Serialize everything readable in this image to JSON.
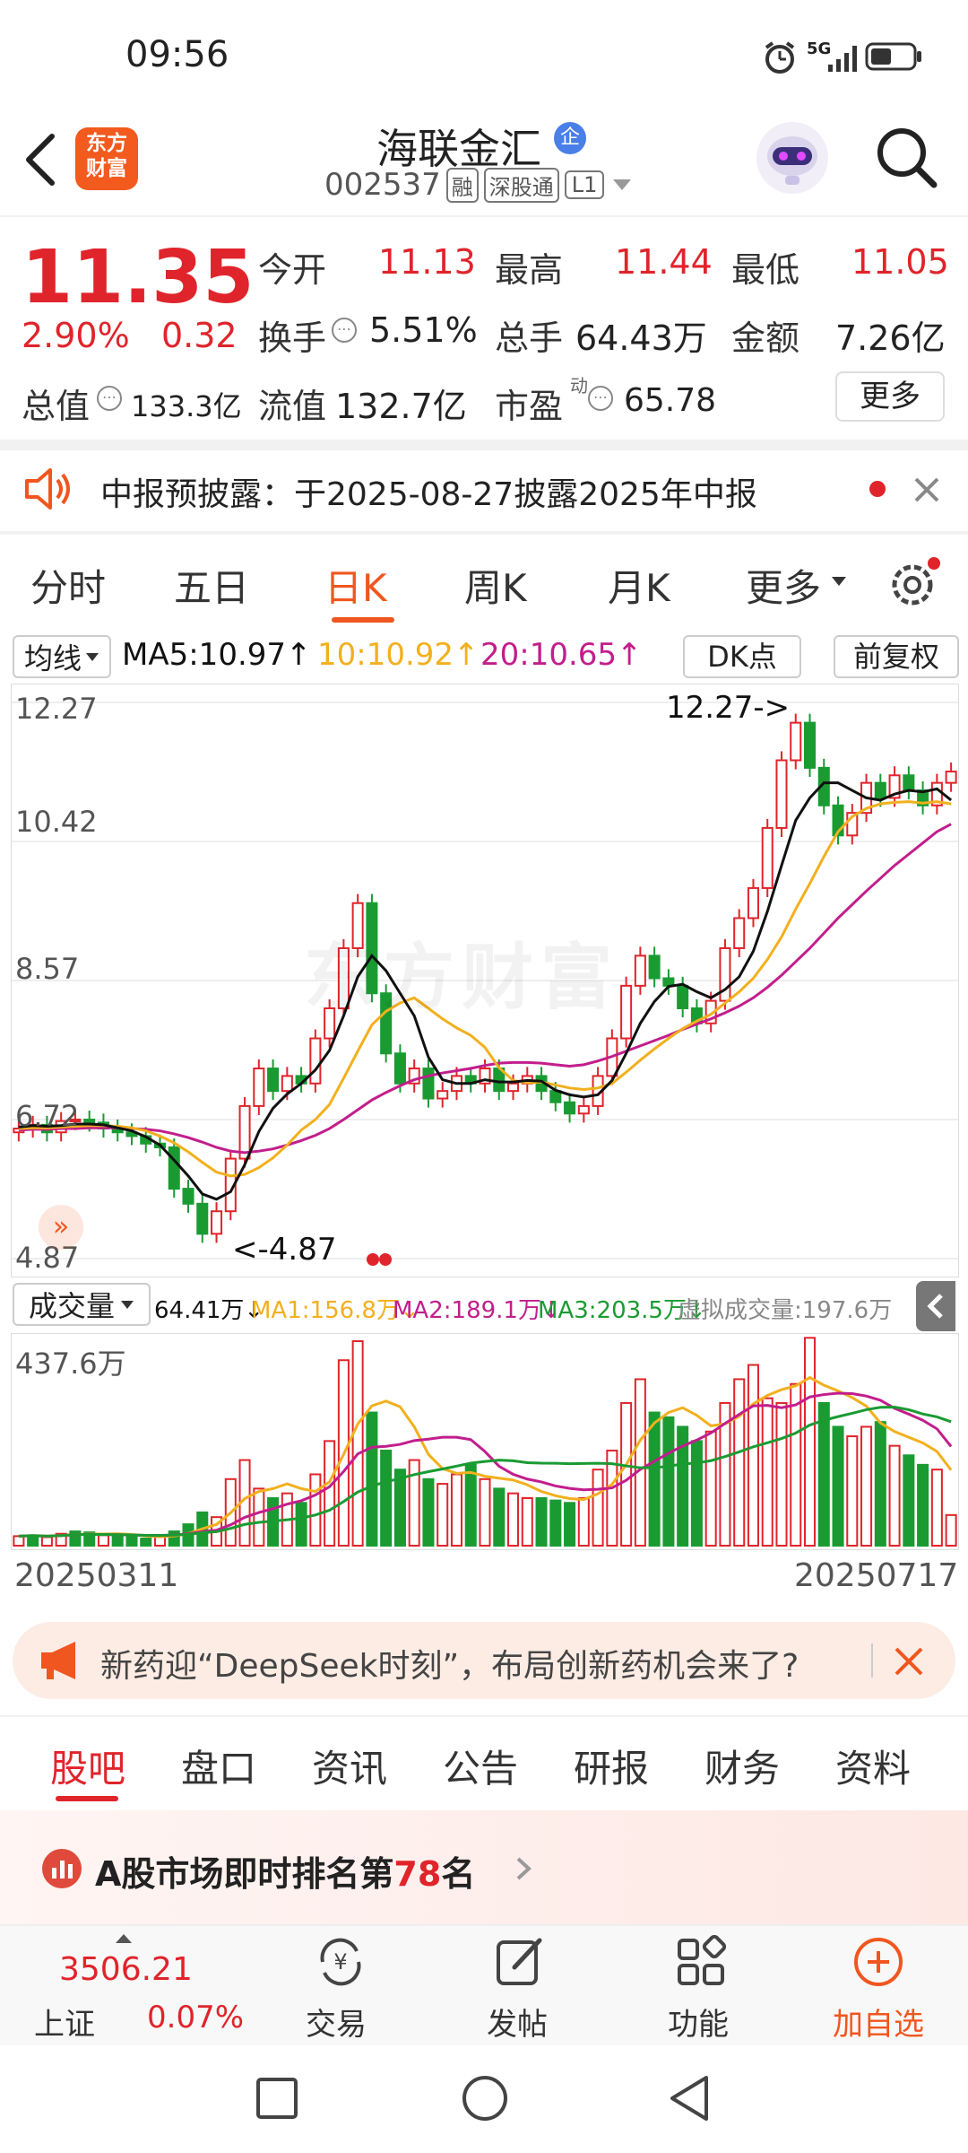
{
  "status_bar": {
    "time": "09:56",
    "network": "5G"
  },
  "header": {
    "logo_line1": "东方",
    "logo_line2": "财富",
    "stock_name": "海联金汇",
    "enterprise_badge": "企",
    "stock_code": "002537",
    "tags": [
      "融",
      "深股通"
    ],
    "level": "L1"
  },
  "quote": {
    "price": "11.35",
    "change_pct": "2.90%",
    "change_abs": "0.32",
    "open_label": "今开",
    "open": "11.13",
    "high_label": "最高",
    "high": "11.44",
    "low_label": "最低",
    "low": "11.05",
    "turnover_label": "换手",
    "turnover": "5.51%",
    "volume_label": "总手",
    "volume": "64.43万",
    "amount_label": "金额",
    "amount": "7.26亿",
    "mktcap_label": "总值",
    "mktcap": "133.3亿",
    "float_label": "流值",
    "float": "132.7亿",
    "pe_label": "市盈",
    "pe_superscript": "动",
    "pe": "65.78",
    "more_button": "更多"
  },
  "notice": {
    "text": "中报预披露：于2025-08-27披露2025年中报"
  },
  "chart_tabs": [
    "分时",
    "五日",
    "日K",
    "周K",
    "月K",
    "更多"
  ],
  "chart_tab_active": "日K",
  "chart_controls": {
    "indicator": "均线",
    "ma5": "MA5:10.97↑",
    "ma10": "10:10.92↑",
    "ma20": "20:10.65↑",
    "dk_button": "DK点",
    "adjust_button": "前复权"
  },
  "colors": {
    "up": "#e0242b",
    "down": "#1a9b32",
    "ma5": "#111111",
    "ma10": "#f2b01e",
    "ma20": "#c21e8c",
    "accent": "#f0561f",
    "vol_ma3": "#1a9b32"
  },
  "chart_data": [
    {
      "type": "candlestick",
      "y_ticks": [
        "12.27",
        "10.42",
        "8.57",
        "6.72",
        "4.87"
      ],
      "ylim": [
        4.87,
        12.27
      ],
      "max_annotation": "12.27->",
      "min_annotation": "<-4.87",
      "watermark": "东方财富",
      "close": [
        6.6,
        6.65,
        6.55,
        6.7,
        6.72,
        6.68,
        6.6,
        6.55,
        6.5,
        6.4,
        6.35,
        5.8,
        5.6,
        5.2,
        5.5,
        6.2,
        6.9,
        7.4,
        7.1,
        7.3,
        7.2,
        7.8,
        8.2,
        9.0,
        9.6,
        8.4,
        7.6,
        7.2,
        7.4,
        7.0,
        7.1,
        7.3,
        7.2,
        7.4,
        7.1,
        7.2,
        7.3,
        7.1,
        6.95,
        6.8,
        6.9,
        7.3,
        7.8,
        8.5,
        8.9,
        8.6,
        8.5,
        8.2,
        8.0,
        8.3,
        9.0,
        9.4,
        9.8,
        10.6,
        11.5,
        12.0,
        11.4,
        10.9,
        10.5,
        10.8,
        11.2,
        11.0,
        11.3,
        11.1,
        10.9,
        11.2,
        11.35
      ],
      "ma5": [
        6.62,
        6.64,
        6.63,
        6.64,
        6.66,
        6.66,
        6.65,
        6.61,
        6.57,
        6.49,
        6.38,
        6.18,
        5.97,
        5.73,
        5.66,
        5.76,
        6.12,
        6.56,
        6.87,
        7.06,
        7.2,
        7.38,
        7.64,
        8.1,
        8.62,
        8.9,
        8.7,
        8.4,
        8.1,
        7.55,
        7.25,
        7.2,
        7.2,
        7.25,
        7.22,
        7.22,
        7.24,
        7.23,
        7.11,
        7.05,
        7.02,
        7.05,
        7.24,
        7.6,
        8.0,
        8.29,
        8.49,
        8.52,
        8.42,
        8.34,
        8.45,
        8.62,
        8.96,
        9.49,
        10.1,
        10.7,
        11.0,
        11.2,
        11.2,
        11.1,
        11.0,
        10.97,
        11.05,
        11.1,
        11.08,
        11.12,
        10.97
      ],
      "ma10": [
        6.6,
        6.61,
        6.61,
        6.62,
        6.63,
        6.64,
        6.64,
        6.63,
        6.61,
        6.57,
        6.5,
        6.41,
        6.29,
        6.15,
        6.02,
        5.97,
        5.99,
        6.08,
        6.21,
        6.38,
        6.58,
        6.72,
        6.92,
        7.27,
        7.63,
        7.98,
        8.16,
        8.27,
        8.34,
        8.2,
        8.06,
        7.94,
        7.84,
        7.68,
        7.41,
        7.24,
        7.21,
        7.22,
        7.18,
        7.14,
        7.12,
        7.14,
        7.2,
        7.35,
        7.51,
        7.66,
        7.8,
        7.93,
        8.03,
        8.12,
        8.27,
        8.42,
        8.6,
        8.85,
        9.15,
        9.52,
        9.86,
        10.22,
        10.55,
        10.75,
        10.86,
        10.92,
        10.94,
        10.95,
        10.93,
        10.95,
        10.92
      ],
      "ma20": [
        6.58,
        6.59,
        6.59,
        6.6,
        6.6,
        6.61,
        6.61,
        6.61,
        6.6,
        6.59,
        6.57,
        6.53,
        6.48,
        6.42,
        6.35,
        6.3,
        6.28,
        6.3,
        6.33,
        6.38,
        6.44,
        6.51,
        6.6,
        6.72,
        6.85,
        6.98,
        7.08,
        7.17,
        7.25,
        7.3,
        7.34,
        7.37,
        7.4,
        7.44,
        7.47,
        7.48,
        7.48,
        7.47,
        7.45,
        7.43,
        7.45,
        7.5,
        7.56,
        7.63,
        7.7,
        7.77,
        7.84,
        7.92,
        7.99,
        8.06,
        8.14,
        8.23,
        8.34,
        8.48,
        8.64,
        8.82,
        9.0,
        9.2,
        9.4,
        9.58,
        9.76,
        9.93,
        10.1,
        10.25,
        10.4,
        10.55,
        10.65
      ]
    },
    {
      "type": "bar",
      "label": "成交量",
      "current": "64.41万↓",
      "ma1": "MA1:156.8万↓",
      "ma2": "MA2:189.1万↓",
      "ma3": "MA3:203.5万↓",
      "virtual": "虚拟成交量:197.6万",
      "y_max_label": "437.6万",
      "x_start": "20250311",
      "x_end": "20250717",
      "ylim": [
        0,
        437.6
      ],
      "values": [
        20,
        22,
        18,
        25,
        30,
        28,
        22,
        20,
        18,
        15,
        18,
        30,
        45,
        70,
        60,
        140,
        180,
        120,
        100,
        110,
        90,
        150,
        220,
        390,
        430,
        280,
        200,
        160,
        180,
        140,
        130,
        150,
        170,
        140,
        120,
        110,
        100,
        100,
        95,
        90,
        100,
        160,
        200,
        300,
        350,
        280,
        270,
        250,
        220,
        240,
        300,
        350,
        380,
        310,
        300,
        340,
        437,
        300,
        250,
        230,
        250,
        260,
        210,
        190,
        170,
        160,
        64.41
      ],
      "up": [
        true,
        false,
        true,
        true,
        false,
        false,
        true,
        false,
        false,
        false,
        true,
        false,
        false,
        false,
        true,
        true,
        true,
        true,
        false,
        true,
        false,
        true,
        true,
        true,
        true,
        false,
        false,
        false,
        true,
        false,
        true,
        true,
        false,
        true,
        false,
        true,
        true,
        false,
        false,
        false,
        true,
        true,
        true,
        true,
        true,
        false,
        false,
        false,
        false,
        true,
        true,
        true,
        true,
        true,
        true,
        true,
        true,
        false,
        false,
        true,
        true,
        false,
        true,
        false,
        false,
        true,
        true
      ]
    }
  ],
  "ad_banner": {
    "text": "新药迎“DeepSeek时刻”，布局创新药机会来了?"
  },
  "sub_tabs": [
    "股吧",
    "盘口",
    "资讯",
    "公告",
    "研报",
    "财务",
    "资料"
  ],
  "sub_tab_active": "股吧",
  "ranking": {
    "prefix": "A股市场即时排名第",
    "rank": "78",
    "suffix": "名"
  },
  "bottom_nav": {
    "index_value": "3506.21",
    "index_name": "上证",
    "index_change": "0.07%",
    "items": [
      "交易",
      "发帖",
      "功能",
      "加自选"
    ]
  }
}
